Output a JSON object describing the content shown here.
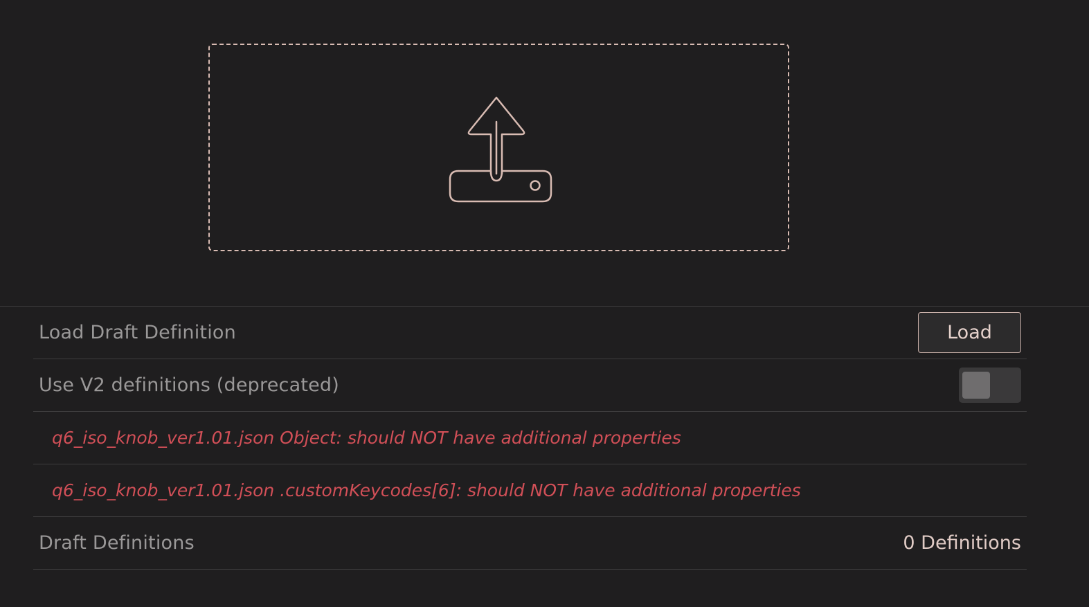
{
  "dropzone": {
    "icon": "upload-icon",
    "accent_color": "#d9bcb3"
  },
  "settings": {
    "load_draft": {
      "label": "Load Draft Definition",
      "button_label": "Load"
    },
    "use_v2": {
      "label": "Use V2 definitions (deprecated)",
      "toggle_on": false
    },
    "errors": [
      "q6_iso_knob_ver1.01.json Object: should NOT have additional properties",
      "q6_iso_knob_ver1.01.json .customKeycodes[6]: should NOT have additional properties"
    ],
    "draft_definitions": {
      "label": "Draft Definitions",
      "count_text": "0 Definitions"
    }
  },
  "colors": {
    "background": "#1f1e1f",
    "error": "#d14f57",
    "label": "#9a9898",
    "accent": "#e0cbc5"
  }
}
